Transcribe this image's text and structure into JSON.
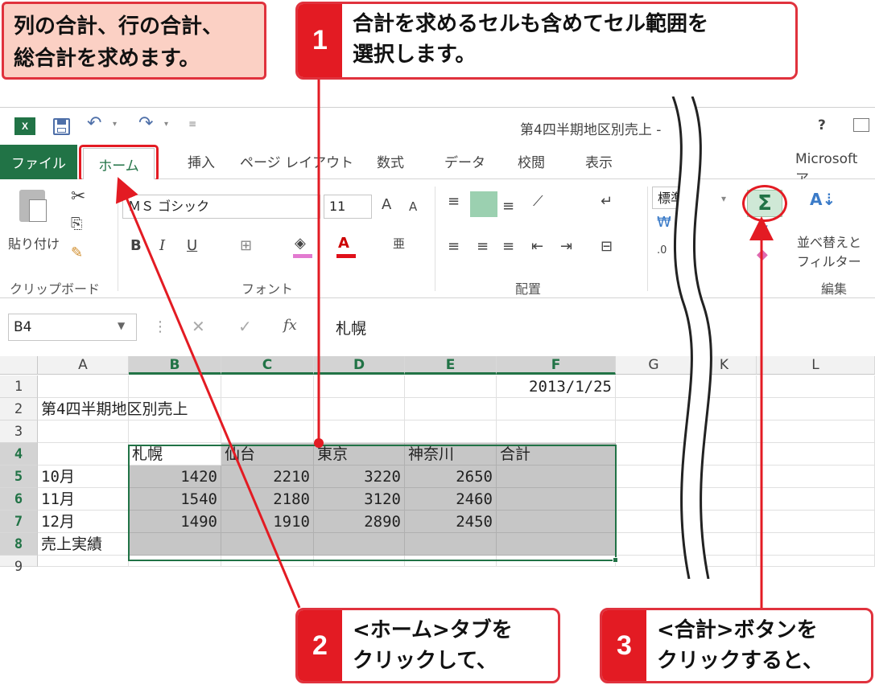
{
  "callouts": {
    "intro": [
      "列の合計、行の合計、",
      "総合計を求めます。"
    ],
    "step1": {
      "num": "1",
      "lines": [
        "合計を求めるセルも含めてセル範囲を",
        "選択します。"
      ]
    },
    "step2": {
      "num": "2",
      "lines": [
        "<ホーム>タブを",
        "クリックして、"
      ]
    },
    "step3": {
      "num": "3",
      "lines": [
        "<合計>ボタンを",
        "クリックすると、"
      ]
    }
  },
  "window": {
    "title": "第4四半期地区別売上 -",
    "help": "?",
    "brand": "Microsoft ア"
  },
  "tabs": {
    "file": "ファイル",
    "home": "ホーム",
    "insert": "挿入",
    "page_layout": "ページ レイアウト",
    "formulas": "数式",
    "data": "データ",
    "review": "校閲",
    "view": "表示"
  },
  "ribbon": {
    "paste": "貼り付け",
    "clipboard": "クリップボード",
    "font_name": "ＭＳ ゴシック",
    "font_size": "11",
    "font_group": "フォント",
    "align_group": "配置",
    "number_format": "標準",
    "sort_filter_1": "並べ替えと",
    "sort_filter_2": "フィルター",
    "edit_group": "編集",
    "sigma": "Σ",
    "bold": "B",
    "italic": "I",
    "underline": "U"
  },
  "formula_bar": {
    "name_box": "B4",
    "fx": "fx",
    "content": "札幌"
  },
  "sheet": {
    "columns": [
      "A",
      "B",
      "C",
      "D",
      "E",
      "F",
      "G",
      "K",
      "L"
    ],
    "rows": [
      "1",
      "2",
      "3",
      "4",
      "5",
      "6",
      "7",
      "8",
      "9"
    ],
    "date": "2013/1/25",
    "title": "第4四半期地区別売上",
    "headers": [
      "札幌",
      "仙台",
      "東京",
      "神奈川",
      "合計"
    ],
    "months": [
      "10月",
      "11月",
      "12月",
      "売上実績"
    ],
    "values": [
      [
        "1420",
        "2210",
        "3220",
        "2650"
      ],
      [
        "1540",
        "2180",
        "3120",
        "2460"
      ],
      [
        "1490",
        "1910",
        "2890",
        "2450"
      ]
    ]
  },
  "colors": {
    "accent": "#e31b23",
    "excel_green": "#217346",
    "selection": "#c6c6c6"
  }
}
